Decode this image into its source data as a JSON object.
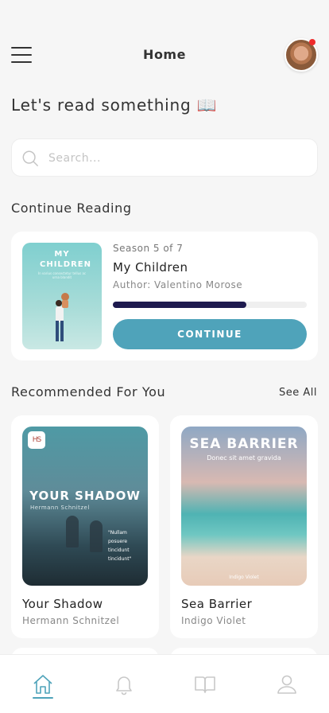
{
  "header": {
    "title": "Home",
    "menu_icon": "hamburger-menu-icon",
    "avatar": "user-avatar",
    "notification_dot_color": "#ee2b2b"
  },
  "greeting": "Let's read something 📖",
  "search": {
    "placeholder": "Search...",
    "value": ""
  },
  "continue_reading": {
    "section_title": "Continue Reading",
    "book": {
      "cover_title": "MY CHILDREN",
      "cover_subtitle": "In varius consectetur tellus ac urna blandit",
      "season": "Season 5 of 7",
      "title": "My Children",
      "author": "Author: Valentino Morose",
      "progress": 0.69
    },
    "button_label": "CONTINUE"
  },
  "recommended": {
    "section_title": "Recommended For You",
    "see_all_label": "See All",
    "books": [
      {
        "title": "Your Shadow",
        "author": "Hermann Schnitzel",
        "cover_title": "YOUR SHADOW",
        "cover_author": "Hermann Schnitzel",
        "cover_badge": "HS",
        "cover_quote": "\"Nullam posuere tincidunt tincidunt\""
      },
      {
        "title": "Sea Barrier",
        "author": "Indigo Violet",
        "cover_title": "SEA BARRIER",
        "cover_subtitle": "Donec sit amet gravida",
        "cover_author": "Indigo Violet"
      }
    ]
  },
  "bottom_nav": [
    {
      "icon": "home-icon",
      "active": true
    },
    {
      "icon": "bell-icon",
      "active": false
    },
    {
      "icon": "open-book-icon",
      "active": false
    },
    {
      "icon": "user-icon",
      "active": false
    }
  ],
  "colors": {
    "accent": "#4fa3ba",
    "progress": "#1e1a4e",
    "background": "#f6f6f6"
  }
}
